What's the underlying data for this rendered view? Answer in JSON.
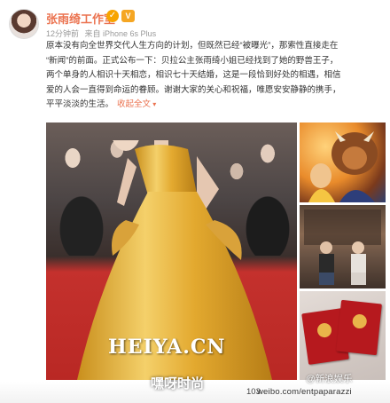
{
  "post": {
    "user_name": "张雨绮工作室",
    "verified_badge": "✓",
    "vip_badge": "V",
    "time": "12分钟前",
    "source": "来自 iPhone 6s Plus",
    "text_lines": [
      "原本没有向全世界交代人生方向的计划，但既然已经“被曝光”，那索性直接走在",
      "“新闻”的前面。正式公布一下：贝拉公主张雨绮小姐已经找到了她的野兽王子，",
      "两个单身的人相识十天相恋，相识七十天结婚，这是一段恰到好处的相遇，相信",
      "爱的人会一直得到命运的眷顾。谢谢大家的关心和祝福，唯愿安安静静的携手，",
      "平平淡淡的生活。"
    ],
    "expand_label": "收起全文"
  },
  "images": {
    "main_watermark": "HEIYA.CN",
    "main_icon": "red-carpet-golden-gown-photo",
    "side_icons": [
      "beauty-and-beast-illustration",
      "couple-seated-photo",
      "marriage-certificate-photo"
    ]
  },
  "footer": {
    "site_watermark": "嘿呀时尚",
    "count": "103",
    "url": "weibo.com/entpaparazzi",
    "handle": "@新浪娱乐"
  },
  "colors": {
    "accent": "#eb7350",
    "gown": "#e8b33c",
    "carpet": "#c4312d",
    "certificate": "#b6191e"
  }
}
